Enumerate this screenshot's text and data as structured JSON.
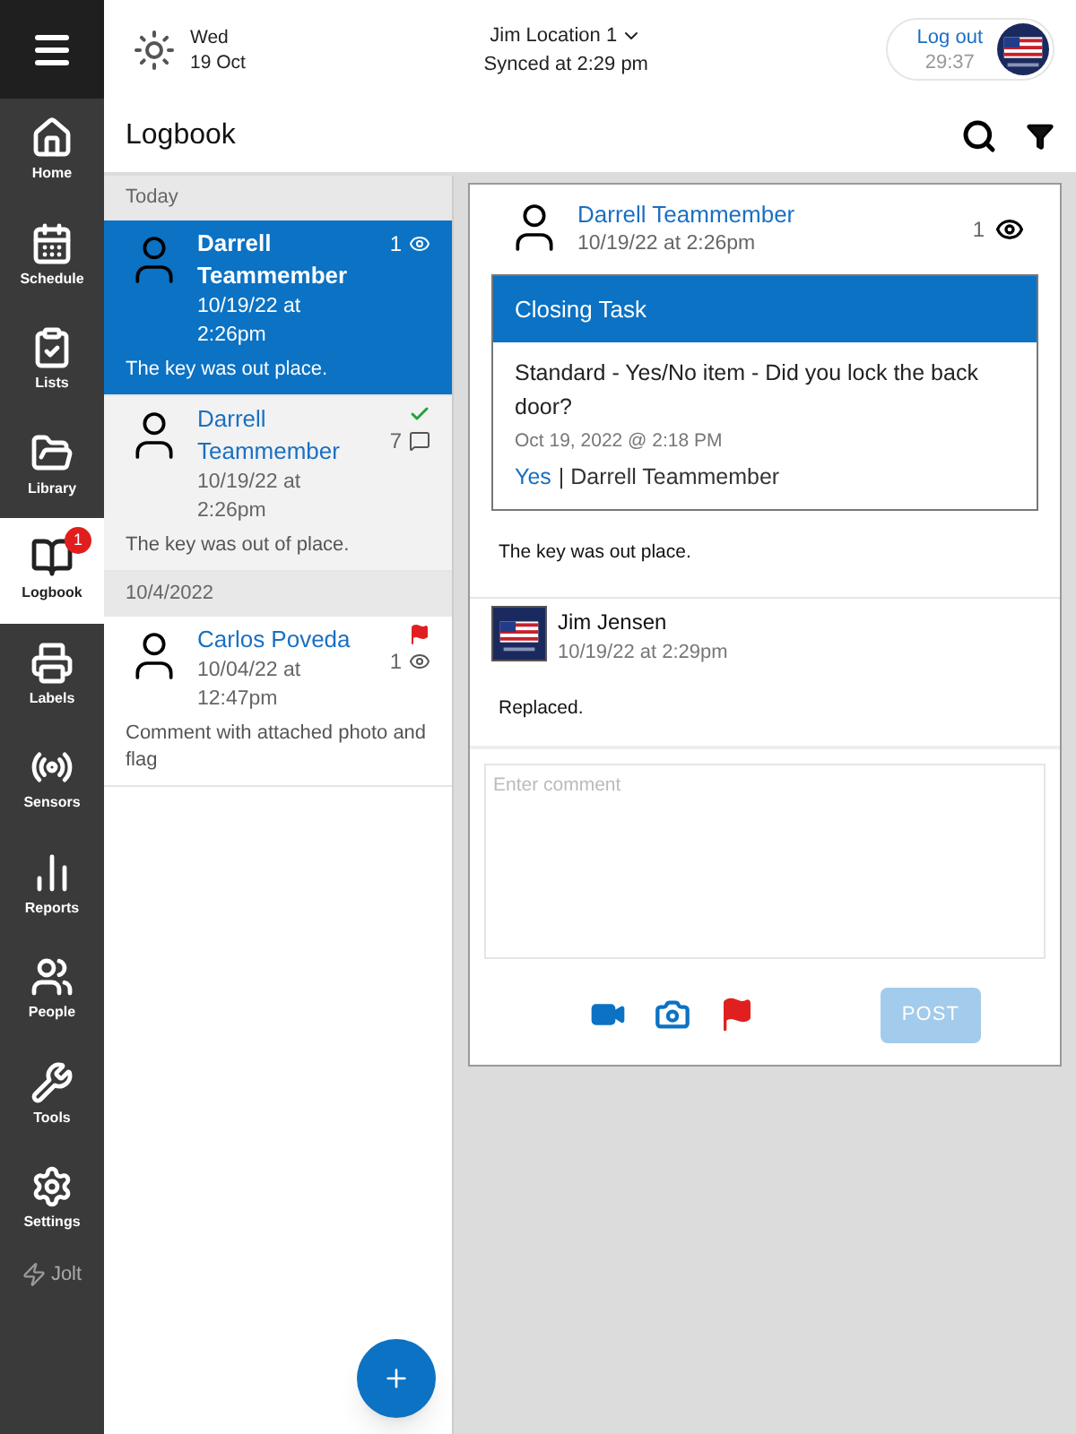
{
  "nav": [
    {
      "label": "Home",
      "selected": false
    },
    {
      "label": "Schedule",
      "selected": false
    },
    {
      "label": "Lists",
      "selected": false
    },
    {
      "label": "Library",
      "selected": false
    },
    {
      "label": "Logbook",
      "selected": true,
      "badge": "1"
    },
    {
      "label": "Labels",
      "selected": false
    },
    {
      "label": "Sensors",
      "selected": false
    },
    {
      "label": "Reports",
      "selected": false
    },
    {
      "label": "People",
      "selected": false
    },
    {
      "label": "Tools",
      "selected": false
    },
    {
      "label": "Settings",
      "selected": false
    }
  ],
  "brand": "Jolt",
  "header": {
    "day": "Wed",
    "date": "19 Oct",
    "location": "Jim Location 1",
    "synced": "Synced at 2:29 pm",
    "logout": "Log out",
    "timer": "29:37"
  },
  "title": "Logbook",
  "groups": [
    {
      "label": "Today",
      "entries": [
        {
          "name": "Darrell Teammember",
          "time": "10/19/22 at 2:26pm",
          "text": "The key was out place.",
          "selected": true,
          "count": {
            "kind": "views",
            "text": "1"
          }
        },
        {
          "name": "Darrell Teammember",
          "time": "10/19/22 at 2:26pm",
          "text": "The key was out of place.",
          "selected": false,
          "count": {
            "kind": "comments",
            "text": "7"
          },
          "marker": {
            "kind": "check"
          }
        }
      ]
    },
    {
      "label": "10/4/2022",
      "entries": [
        {
          "name": "Carlos Poveda",
          "time": "10/04/22 at 12:47pm",
          "text": "Comment with attached photo and flag",
          "selected": false,
          "count": {
            "kind": "views",
            "text": "1"
          },
          "marker": {
            "kind": "flag"
          }
        }
      ]
    }
  ],
  "detail": {
    "name": "Darrell Teammember",
    "time": "10/19/22 at 2:26pm",
    "views": "1",
    "task": {
      "title": "Closing Task",
      "question": "Standard - Yes/No item - Did you lock the back door?",
      "when": "Oct 19, 2022 @ 2:18 PM",
      "answer": "Yes",
      "by": "| Darrell Teammember"
    },
    "text": "The key was out place.",
    "comments": [
      {
        "name": "Jim Jensen",
        "time": "10/19/22 at 2:29pm",
        "text": "Replaced."
      }
    ],
    "comment_field": {
      "placeholder": "Enter comment"
    },
    "post": {
      "label": "POST",
      "disabled": true
    }
  }
}
